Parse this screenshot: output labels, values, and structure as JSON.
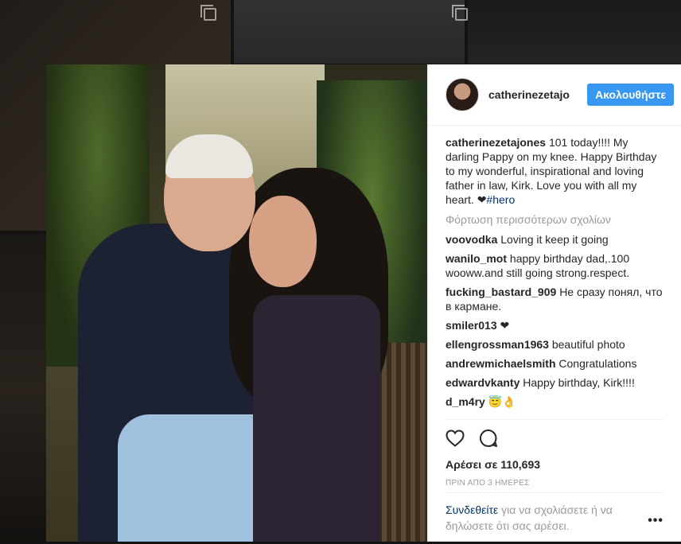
{
  "post": {
    "username": "catherinezetajo",
    "follow_label": "Ακολουθήστε",
    "caption_user": "catherinezetajones",
    "caption_text": "101 today!!!! My darling Pappy on my knee. Happy Birthday to my wonderful, inspirational and loving father in law, Kirk. Love you with all my heart. ❤",
    "caption_hashtag": "#hero",
    "load_more": "Φόρτωση περισσότερων σχολίων",
    "comments": [
      {
        "user": "voovodka",
        "text": "Loving it keep it going"
      },
      {
        "user": "wanilo_mot",
        "text": "happy birthday dad,.100 wooww.and still going strong.respect."
      },
      {
        "user": "fucking_bastard_909",
        "text": "Не сразу понял, что в кармане."
      },
      {
        "user": "smiler013",
        "text": "❤"
      },
      {
        "user": "ellengrossman1963",
        "text": "beautiful photo"
      },
      {
        "user": "andrewmichaelsmith",
        "text": "Congratulations"
      },
      {
        "user": "edwardvkanty",
        "text": "Happy birthday, Kirk!!!!"
      },
      {
        "user": "d_m4ry",
        "text": "😇👌"
      }
    ],
    "likes": "Αρέσει σε 110,693",
    "time_ago": "ΠΡΙΝ ΑΠΟ 3 ΗΜΕΡΕΣ",
    "login_link": "Συνδεθείτε",
    "login_text": " για να σχολιάσετε ή να δηλώσετε ότι σας αρέσει.",
    "more_options": "•••",
    "icons": {
      "like": "heart-icon",
      "comment": "comment-bubble-icon",
      "options": "more-options-icon"
    }
  },
  "colors": {
    "accent": "#3897f0",
    "link": "#003569",
    "muted": "#999999",
    "text": "#262626"
  }
}
